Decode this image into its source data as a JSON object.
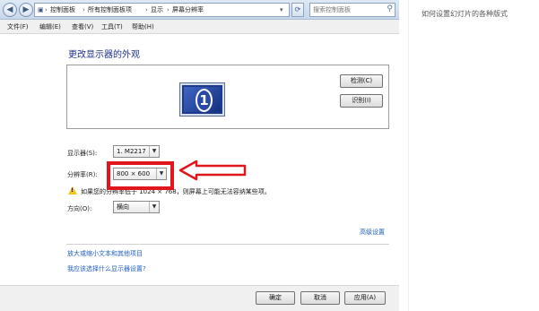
{
  "address_bar": {
    "back_icon": "back-arrow-icon",
    "forward_icon": "forward-arrow-icon",
    "crumbs": [
      "控制面板",
      "所有控制面板项",
      "显示",
      "屏幕分辨率"
    ],
    "search_placeholder": "搜索控制面板"
  },
  "menu": [
    "文件(F)",
    "编辑(E)",
    "查看(V)",
    "工具(T)",
    "帮助(H)"
  ],
  "page_title": "更改显示器的外观",
  "preview": {
    "monitor_number": "1",
    "detect_label": "检测(C)",
    "identify_label": "识别(I)"
  },
  "fields": {
    "display_label": "显示器(S):",
    "display_value": "1. M2217",
    "resolution_label": "分辨率(R):",
    "resolution_value": "800 × 600",
    "warning_text": "如果您的分辨率低于 1024 × 768，则屏幕上可能无法容纳某些项。",
    "orientation_label": "方向(O):",
    "orientation_value": "横向"
  },
  "advanced_link": "高级设置",
  "links": [
    "放大或缩小文本和其他项目",
    "我应该选择什么显示器设置?"
  ],
  "buttons": {
    "ok": "确定",
    "cancel": "取消",
    "apply": "应用(A)"
  },
  "annotation_color": "#e0161c",
  "side_text": "如何设置幻灯片的各种版式"
}
